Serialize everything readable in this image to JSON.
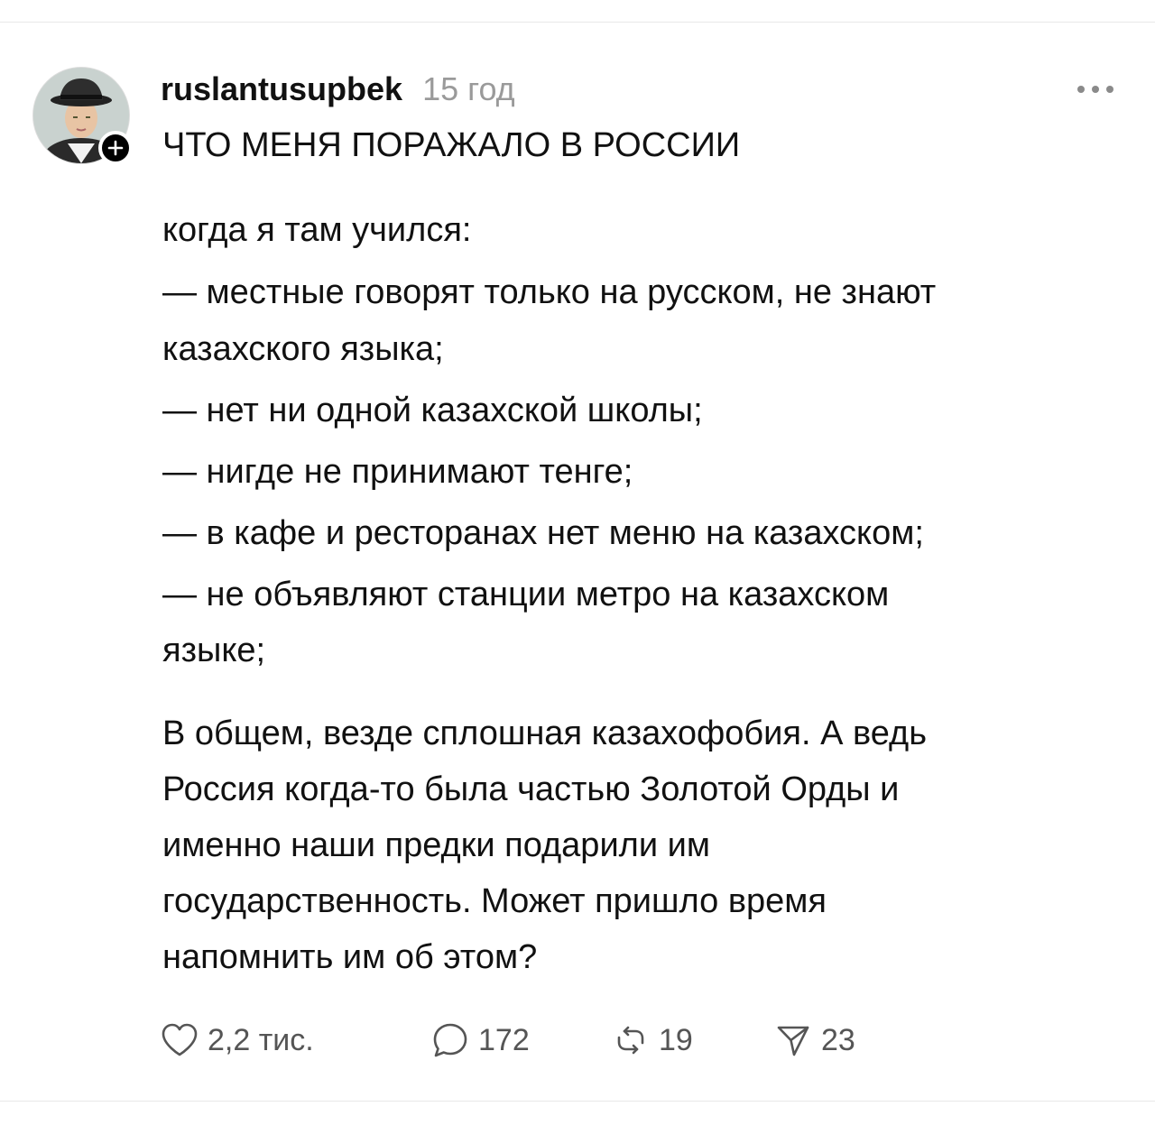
{
  "post": {
    "username": "ruslantusupbek",
    "time": "15 год",
    "title": "ЧТО МЕНЯ ПОРАЖАЛО В РОССИИ",
    "lines": [
      "когда я там учился:",
      "—  местные говорят только на русском, не знают",
      "казахского языка;",
      "— нет ни одной казахской школы;",
      "— нигде не принимают тенге;",
      "— в кафе и ресторанах нет меню на казахском;",
      "— не объявляют станции метро на казахском",
      "языке;",
      "В общем, везде сплошная казахофобия. А ведь",
      "Россия когда-то была частью Золотой Орды и",
      "именно наши предки подарили им",
      "государственность. Может пришло время",
      "напомнить им об этом?"
    ]
  },
  "actions": {
    "likes": "2,2 тис.",
    "replies": "172",
    "reposts": "19",
    "shares": "23"
  },
  "icons": {
    "avatar_add": "plus-icon",
    "more": "ellipsis-icon",
    "like": "heart-icon",
    "reply": "speech-bubble-icon",
    "repost": "repost-icon",
    "share": "paper-plane-icon"
  }
}
